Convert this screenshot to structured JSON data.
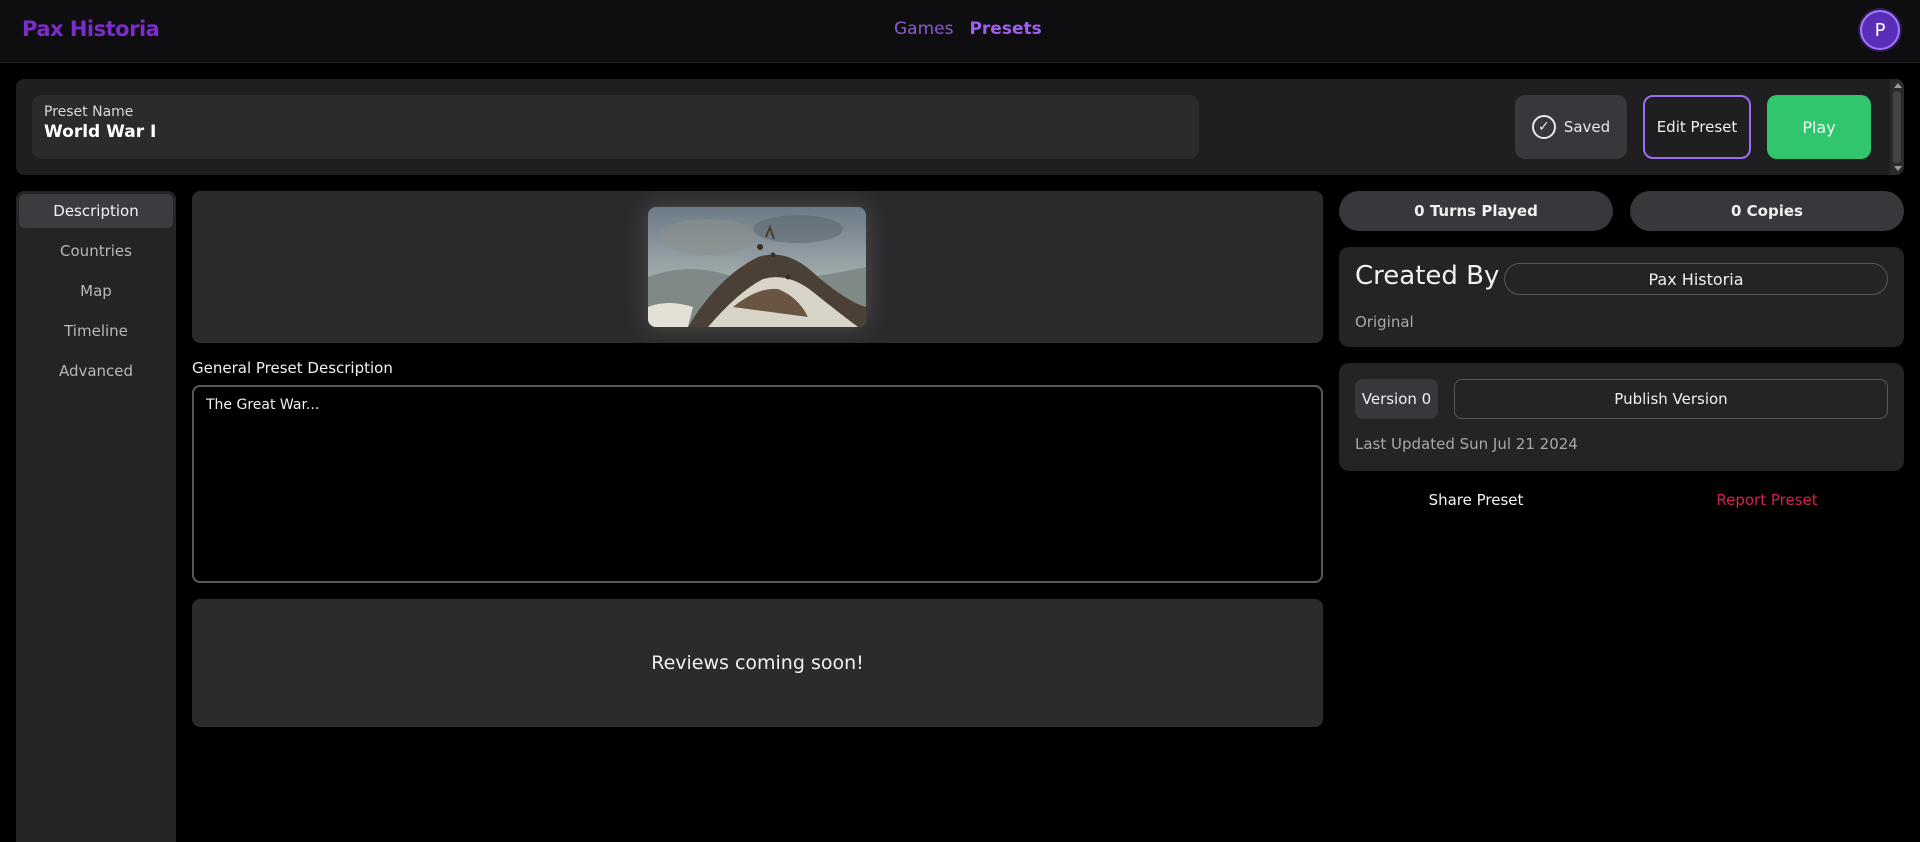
{
  "app": {
    "brand": "Pax Historia"
  },
  "nav": {
    "games": "Games",
    "presets": "Presets"
  },
  "user": {
    "avatar_initial": "P"
  },
  "preset": {
    "name_label": "Preset Name",
    "name_value": "World War I",
    "saved_label": "Saved",
    "edit_label": "Edit Preset",
    "play_label": "Play"
  },
  "sidebar": {
    "items": [
      {
        "label": "Description"
      },
      {
        "label": "Countries"
      },
      {
        "label": "Map"
      },
      {
        "label": "Timeline"
      },
      {
        "label": "Advanced"
      }
    ]
  },
  "description": {
    "label": "General Preset Description",
    "value": "The Great War..."
  },
  "reviews": {
    "text": "Reviews coming soon!"
  },
  "stats": {
    "turns_played": "0 Turns Played",
    "copies": "0 Copies"
  },
  "creator": {
    "title": "Created By",
    "name": "Pax Historia",
    "origin": "Original"
  },
  "version": {
    "badge": "Version 0",
    "publish_label": "Publish Version",
    "last_updated": "Last Updated Sun Jul 21 2024"
  },
  "actions": {
    "share": "Share Preset",
    "report": "Report Preset"
  },
  "colors": {
    "brand": "#7b2cc9",
    "play": "#2fc66e",
    "edit_border": "#9a6ef0",
    "report": "#d4214f"
  }
}
